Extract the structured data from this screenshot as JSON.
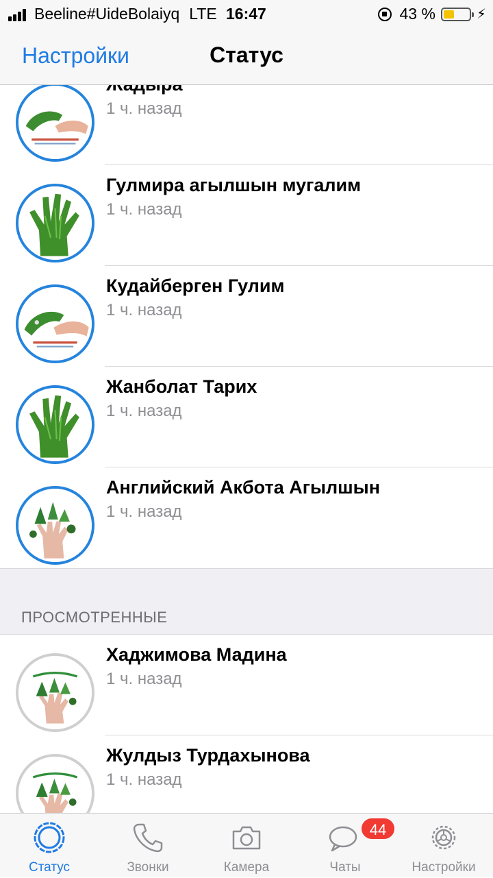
{
  "status_bar": {
    "carrier": "Beeline#UideBolaiyq",
    "network": "LTE",
    "time": "16:47",
    "battery": "43 %",
    "battery_level": 0.43
  },
  "nav": {
    "back_label": "Настройки",
    "title": "Статус"
  },
  "recent": [
    {
      "name": "Жадыра",
      "time": "1 ч. назад",
      "avatar": "hands-image"
    },
    {
      "name": "Гулмира агылшын мугалим",
      "time": "1 ч. назад",
      "avatar": "green-hand-image"
    },
    {
      "name": "Кудайберген Гулим",
      "time": "1 ч. назад",
      "avatar": "hands-image"
    },
    {
      "name": "Жанболат Тарих",
      "time": "1 ч. назад",
      "avatar": "green-hand-image"
    },
    {
      "name": "Английский Акбота Агылшын",
      "time": "1 ч. назад",
      "avatar": "tree-fingers-image"
    }
  ],
  "viewed_section": {
    "title": "ПРОСМОТРЕННЫЕ"
  },
  "viewed": [
    {
      "name": "Хаджимова Мадина",
      "time": "1 ч. назад",
      "avatar": "school-logo-image"
    },
    {
      "name": "Жулдыз Турдахынова",
      "time": "1 ч. назад",
      "avatar": "school-logo-image"
    }
  ],
  "tabs": [
    {
      "label": "Статус",
      "icon": "status-icon",
      "active": true
    },
    {
      "label": "Звонки",
      "icon": "phone-icon"
    },
    {
      "label": "Камера",
      "icon": "camera-icon"
    },
    {
      "label": "Чаты",
      "icon": "chats-icon",
      "badge": "44"
    },
    {
      "label": "Настройки",
      "icon": "settings-gear-icon"
    }
  ],
  "colors": {
    "accent": "#1f7be3",
    "unseen_ring": "#2584dd",
    "seen_ring": "#cfcfcf",
    "badge": "#f03a32"
  }
}
